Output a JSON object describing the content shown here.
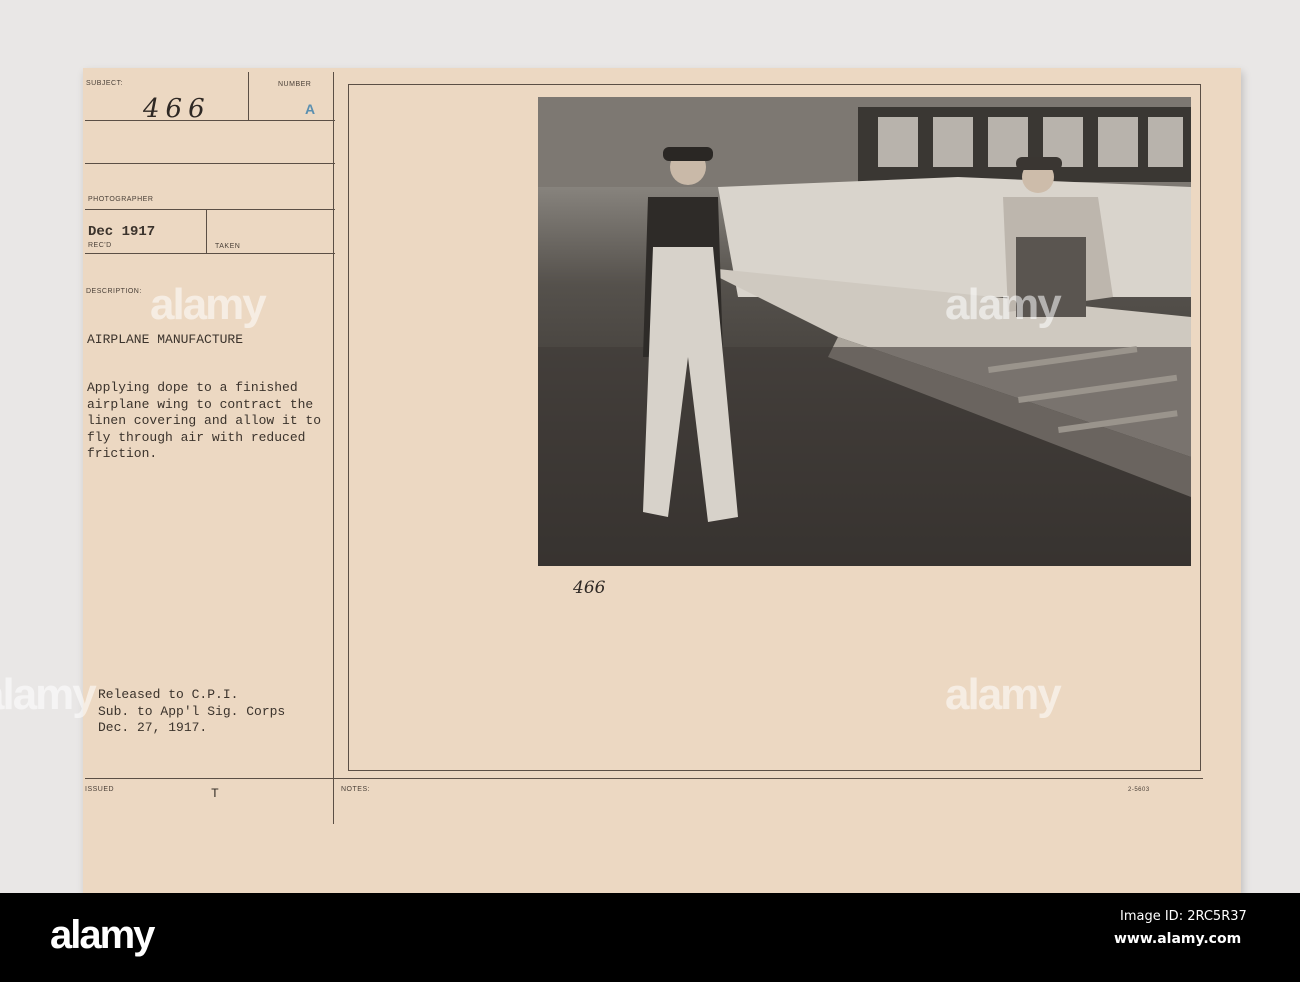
{
  "card": {
    "subject_label": "SUBJECT:",
    "subject_value": "466",
    "number_label": "NUMBER",
    "number_value": "A",
    "photographer_label": "PHOTOGRAPHER",
    "recd_value": "Dec 1917",
    "recd_label": "REC'D",
    "taken_label": "TAKEN",
    "description_label": "DESCRIPTION:",
    "title": "AIRPLANE MANUFACTURE",
    "description_lines": [
      "Applying dope to a finished",
      "airplane wing to contract the",
      "linen covering and allow it to",
      "fly through air with reduced",
      "friction."
    ],
    "release_lines": [
      "Released to C.P.I.",
      "Sub. to App'l Sig. Corps",
      "Dec. 27, 1917."
    ],
    "issued_label": "ISSUED",
    "issued_value": "T",
    "notes_label": "NOTES:",
    "photo_handwritten_number": "466",
    "form_number": "2-5603"
  },
  "watermark": "alamy",
  "footer": {
    "logo": "alamy",
    "image_id": "Image ID: 2RC5R37",
    "url": "www.alamy.com"
  },
  "colors": {
    "card": "#ecd8c2",
    "stamp": "#5a8fb0",
    "footer": "#000000"
  }
}
